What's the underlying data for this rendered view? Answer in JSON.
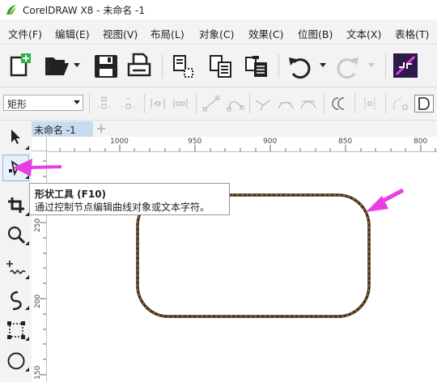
{
  "window": {
    "title": "CorelDRAW X8 - 未命名 -1"
  },
  "menu": {
    "items": [
      "文件(F)",
      "编辑(E)",
      "视图(V)",
      "布局(L)",
      "对象(C)",
      "效果(C)",
      "位图(B)",
      "文本(X)",
      "表格(T)"
    ]
  },
  "property_bar": {
    "shape_type": "矩形"
  },
  "document": {
    "tab_label": "未命名 -1"
  },
  "ruler": {
    "top_labels": [
      "1000",
      "950",
      "900",
      "850",
      "800"
    ],
    "left_labels": [
      "250",
      "200",
      "150"
    ]
  },
  "tooltip": {
    "title": "形状工具 (F10)",
    "description": "通过控制节点编辑曲线对象或文本字符。"
  },
  "colors": {
    "accent_arrow": "#e83fe3",
    "tab_active": "#c7dcf0",
    "shape_outline": "#3a2a18",
    "shape_dash": "#e88a2a"
  },
  "icons": {
    "toolbar": [
      "new-document-icon",
      "open-folder-icon",
      "save-icon",
      "print-icon",
      "import-icon",
      "export-icon",
      "publish-pdf-icon",
      "undo-icon",
      "redo-icon",
      "align-icon"
    ],
    "toolbox": [
      "pick-tool-icon",
      "shape-tool-icon",
      "crop-tool-icon",
      "zoom-tool-icon",
      "freehand-tool-icon",
      "artistic-media-icon",
      "rectangle-tool-icon",
      "ellipse-tool-icon"
    ]
  }
}
